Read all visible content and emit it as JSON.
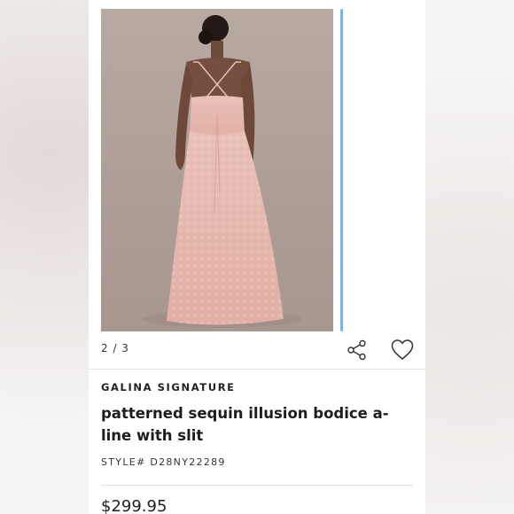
{
  "gallery": {
    "counter": "2 / 3",
    "image_alt": "model wearing pink sequin gown, back view"
  },
  "actions": {
    "share_icon": "share-icon",
    "favorite_icon": "heart-icon"
  },
  "product": {
    "brand": "GALINA SIGNATURE",
    "title": "patterned sequin illusion bodice a-line with slit",
    "style_number": "STYLE# D28NY22289",
    "price": "$299.95"
  },
  "colors": {
    "accent_scroll": "#7fb2e0",
    "dress_pink": "#e6b9b0",
    "backdrop": "#b3a49d"
  }
}
